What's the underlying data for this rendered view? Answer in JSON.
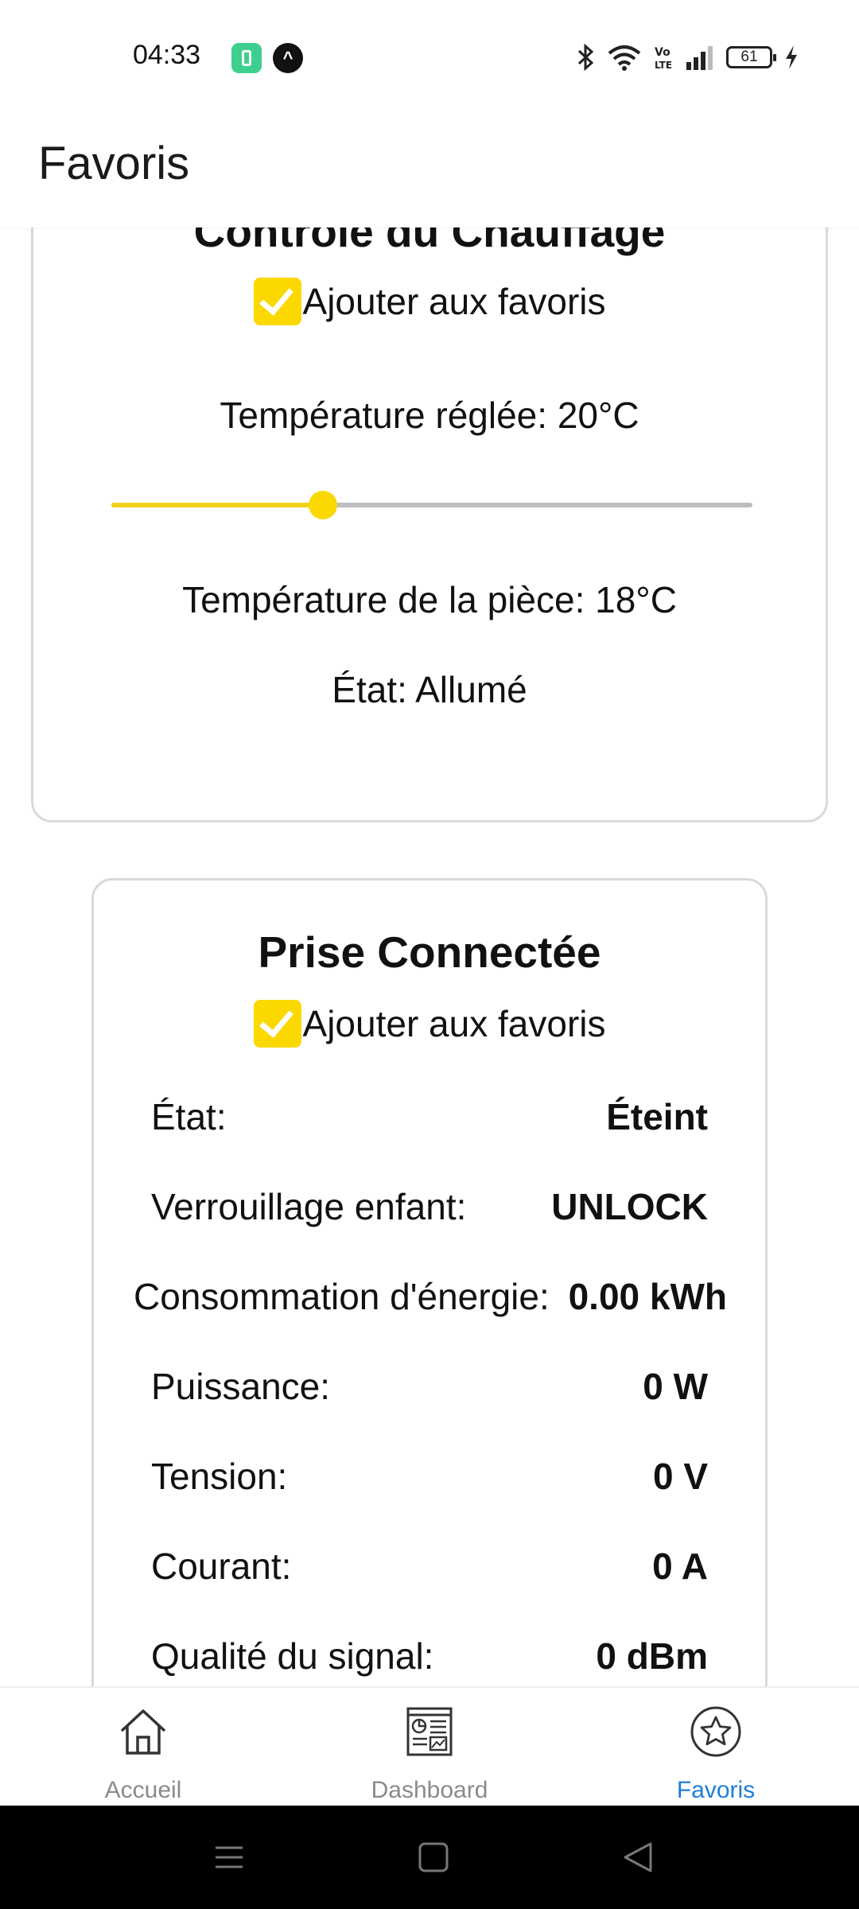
{
  "status_bar": {
    "time": "04:33",
    "battery": "61"
  },
  "header": {
    "title": "Favoris"
  },
  "heating": {
    "title": "Contrôle du Chauffage",
    "favorite_label": "Ajouter aux favoris",
    "favorite_checked": true,
    "set_temp_text": "Température réglée: 20°C",
    "slider_fraction": 0.33,
    "room_temp_text": "Température de la pièce: 18°C",
    "state_text": "État: Allumé"
  },
  "plug": {
    "title": "Prise Connectée",
    "favorite_label": "Ajouter aux favoris",
    "favorite_checked": true,
    "rows": [
      {
        "label": "État:",
        "value": "Éteint"
      },
      {
        "label": "Verrouillage enfant:",
        "value": "UNLOCK"
      },
      {
        "label": "Consommation d'énergie:",
        "value": "0.00 kWh"
      },
      {
        "label": "Puissance:",
        "value": "0 W"
      },
      {
        "label": "Tension:",
        "value": "0 V"
      },
      {
        "label": "Courant:",
        "value": "0 A"
      },
      {
        "label": "Qualité du signal:",
        "value": "0 dBm"
      }
    ]
  },
  "nav": {
    "items": [
      {
        "label": "Accueil",
        "icon": "home-icon",
        "active": false
      },
      {
        "label": "Dashboard",
        "icon": "dashboard-icon",
        "active": false
      },
      {
        "label": "Favoris",
        "icon": "star-icon",
        "active": true
      }
    ]
  },
  "colors": {
    "accent": "#fbd800",
    "active_nav": "#1e7dd8",
    "inactive_nav": "#8a8a8a"
  }
}
